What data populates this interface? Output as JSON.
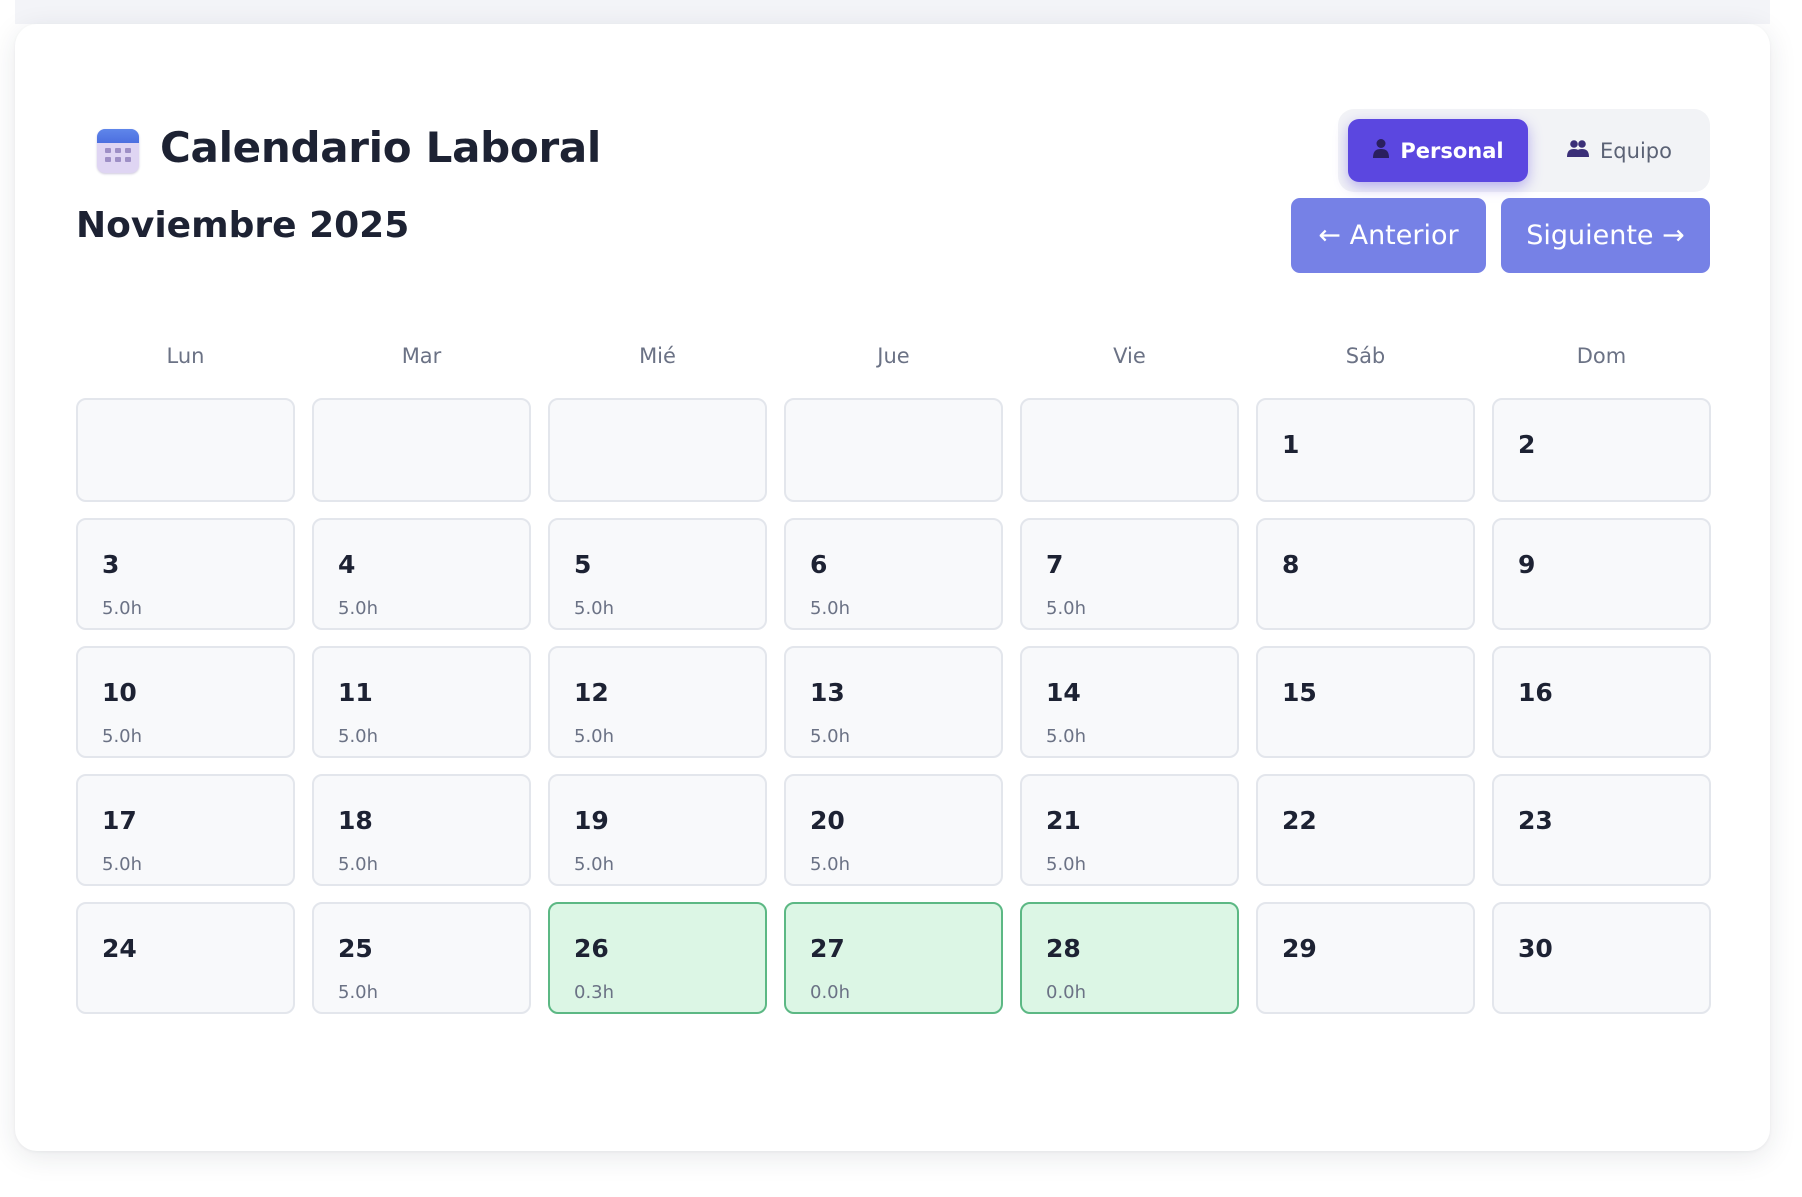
{
  "header": {
    "title": "Calendario Laboral",
    "title_icon": "calendar-icon"
  },
  "view_toggle": {
    "personal_label": "Personal",
    "personal_icon": "person-icon",
    "team_label": "Equipo",
    "team_icon": "people-icon",
    "active": "Personal"
  },
  "month": {
    "title": "Noviembre 2025"
  },
  "nav": {
    "prev_label": "← Anterior",
    "next_label": "Siguiente →"
  },
  "weekdays": [
    "Lun",
    "Mar",
    "Mié",
    "Jue",
    "Vie",
    "Sáb",
    "Dom"
  ],
  "colors": {
    "accent": "#5b47e0",
    "nav_button": "#7681e6",
    "highlight_fill": "#dcf6e5",
    "highlight_border": "#5cb884"
  },
  "days": [
    {
      "day": "",
      "hours": "",
      "highlight": false
    },
    {
      "day": "",
      "hours": "",
      "highlight": false
    },
    {
      "day": "",
      "hours": "",
      "highlight": false
    },
    {
      "day": "",
      "hours": "",
      "highlight": false
    },
    {
      "day": "",
      "hours": "",
      "highlight": false
    },
    {
      "day": "1",
      "hours": "",
      "highlight": false
    },
    {
      "day": "2",
      "hours": "",
      "highlight": false
    },
    {
      "day": "3",
      "hours": "5.0h",
      "highlight": false
    },
    {
      "day": "4",
      "hours": "5.0h",
      "highlight": false
    },
    {
      "day": "5",
      "hours": "5.0h",
      "highlight": false
    },
    {
      "day": "6",
      "hours": "5.0h",
      "highlight": false
    },
    {
      "day": "7",
      "hours": "5.0h",
      "highlight": false
    },
    {
      "day": "8",
      "hours": "",
      "highlight": false
    },
    {
      "day": "9",
      "hours": "",
      "highlight": false
    },
    {
      "day": "10",
      "hours": "5.0h",
      "highlight": false
    },
    {
      "day": "11",
      "hours": "5.0h",
      "highlight": false
    },
    {
      "day": "12",
      "hours": "5.0h",
      "highlight": false
    },
    {
      "day": "13",
      "hours": "5.0h",
      "highlight": false
    },
    {
      "day": "14",
      "hours": "5.0h",
      "highlight": false
    },
    {
      "day": "15",
      "hours": "",
      "highlight": false
    },
    {
      "day": "16",
      "hours": "",
      "highlight": false
    },
    {
      "day": "17",
      "hours": "5.0h",
      "highlight": false
    },
    {
      "day": "18",
      "hours": "5.0h",
      "highlight": false
    },
    {
      "day": "19",
      "hours": "5.0h",
      "highlight": false
    },
    {
      "day": "20",
      "hours": "5.0h",
      "highlight": false
    },
    {
      "day": "21",
      "hours": "5.0h",
      "highlight": false
    },
    {
      "day": "22",
      "hours": "",
      "highlight": false
    },
    {
      "day": "23",
      "hours": "",
      "highlight": false
    },
    {
      "day": "24",
      "hours": "",
      "highlight": false
    },
    {
      "day": "25",
      "hours": "5.0h",
      "highlight": false
    },
    {
      "day": "26",
      "hours": "0.3h",
      "highlight": true
    },
    {
      "day": "27",
      "hours": "0.0h",
      "highlight": true
    },
    {
      "day": "28",
      "hours": "0.0h",
      "highlight": true
    },
    {
      "day": "29",
      "hours": "",
      "highlight": false
    },
    {
      "day": "30",
      "hours": "",
      "highlight": false
    }
  ]
}
